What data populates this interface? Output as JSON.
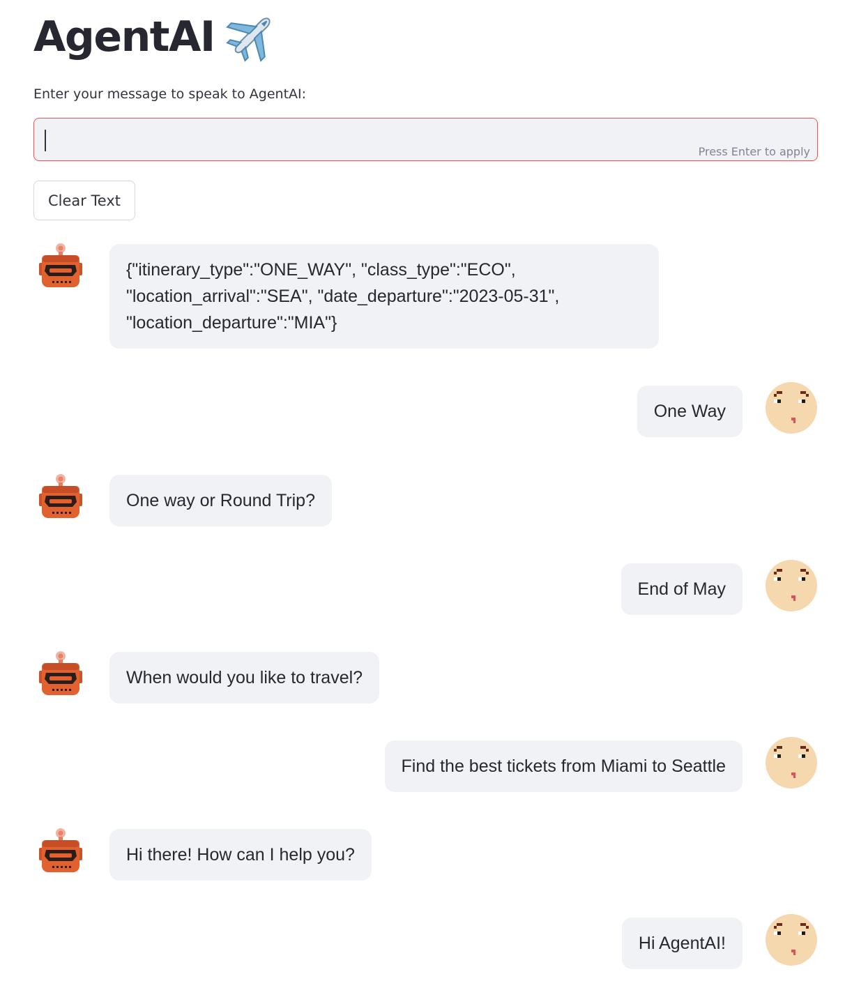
{
  "header": {
    "title": "AgentAI",
    "title_emoji": "airplane-icon"
  },
  "input": {
    "label": "Enter your message to speak to AgentAI:",
    "value": "",
    "hint": "Press Enter to apply"
  },
  "clear_button": {
    "label": "Clear Text"
  },
  "chat": {
    "messages": [
      {
        "role": "bot",
        "avatar": "robot-avatar-icon",
        "text": "{\"itinerary_type\":\"ONE_WAY\", \"class_type\":\"ECO\", \"location_arrival\":\"SEA\", \"date_departure\":\"2023-05-31\", \"location_departure\":\"MIA\"}"
      },
      {
        "role": "user",
        "avatar": "face-avatar-icon",
        "text": "One Way"
      },
      {
        "role": "bot",
        "avatar": "robot-avatar-icon",
        "text": "One way or Round Trip?"
      },
      {
        "role": "user",
        "avatar": "face-avatar-icon",
        "text": "End of May"
      },
      {
        "role": "bot",
        "avatar": "robot-avatar-icon",
        "text": "When would you like to travel?"
      },
      {
        "role": "user",
        "avatar": "face-avatar-icon",
        "text": "Find the best tickets from Miami to Seattle"
      },
      {
        "role": "bot",
        "avatar": "robot-avatar-icon",
        "text": "Hi there! How can I help you?"
      },
      {
        "role": "user",
        "avatar": "face-avatar-icon",
        "text": "Hi AgentAI!"
      }
    ]
  },
  "colors": {
    "accent_border": "#ff4b4b",
    "input_bg": "#f0f2f6",
    "bubble_bg": "#f0f2f6",
    "text": "#31333f"
  }
}
